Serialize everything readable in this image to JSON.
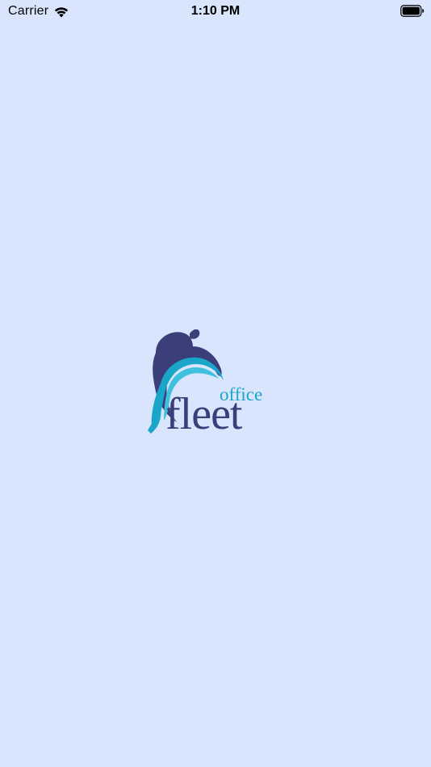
{
  "status_bar": {
    "carrier": "Carrier",
    "time": "1:10 PM",
    "wifi_icon": "wifi-icon",
    "battery_icon": "battery-icon"
  },
  "splash": {
    "logo_icon": "office-fleet-dolphin-logo",
    "logo_text_small": "office",
    "logo_text_large": "fleet"
  },
  "colors": {
    "background": "#d8e5fc",
    "logo_dark": "#3a3f7a",
    "logo_teal": "#1aa6c8",
    "logo_light": "#3fc1de"
  }
}
